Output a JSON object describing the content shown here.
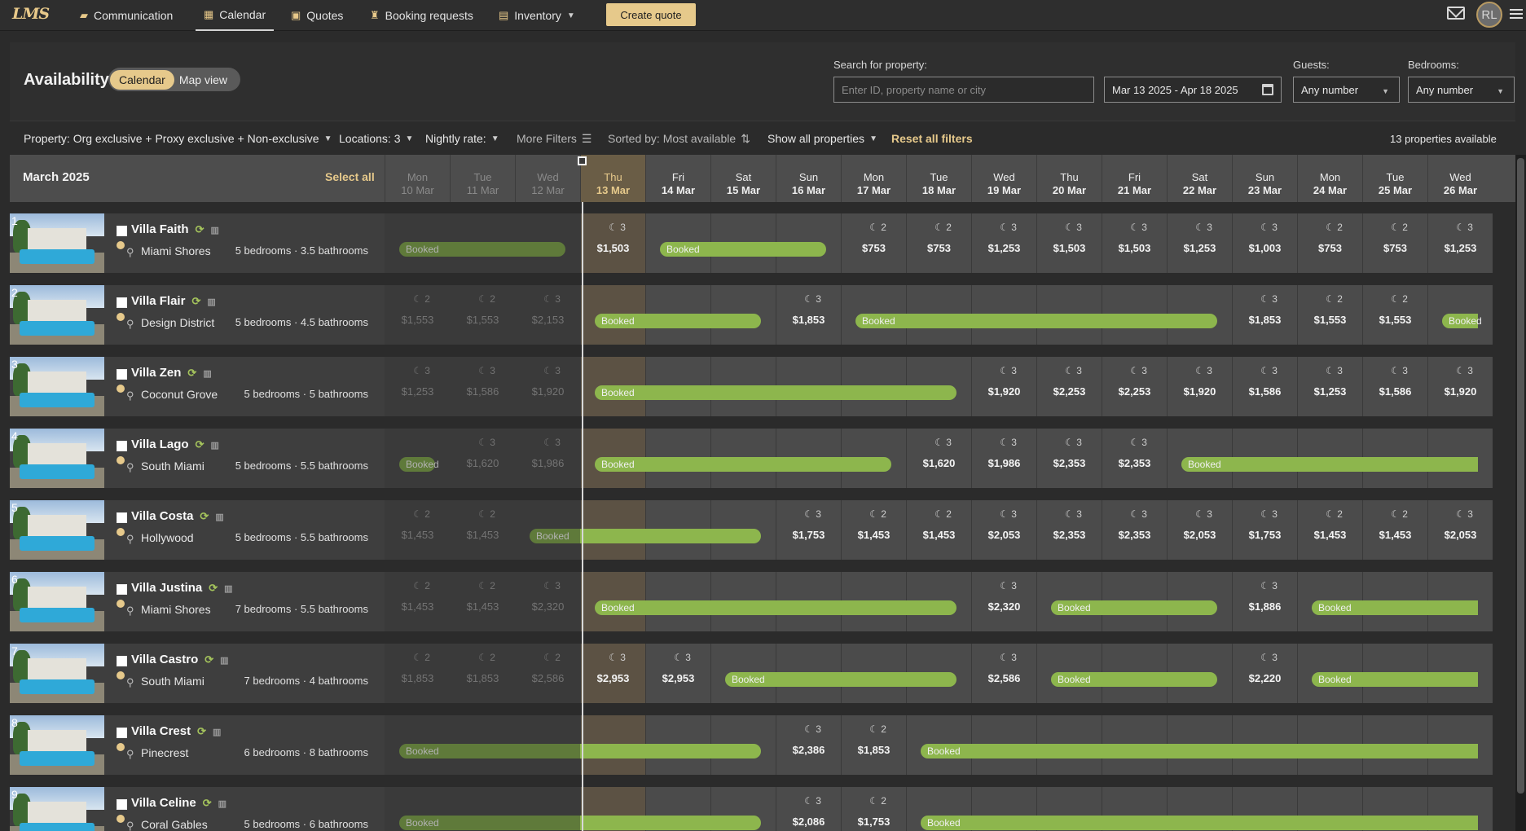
{
  "nav": {
    "logo": "LMS",
    "items": [
      {
        "label": "Communication",
        "icon": "chat-icon"
      },
      {
        "label": "Calendar",
        "icon": "calendar-icon",
        "active": true
      },
      {
        "label": "Quotes",
        "icon": "quote-icon"
      },
      {
        "label": "Booking requests",
        "icon": "person-icon"
      },
      {
        "label": "Inventory",
        "icon": "inventory-icon"
      }
    ],
    "create_quote": "Create quote",
    "user_initials": "RL"
  },
  "toolbar": {
    "title": "Availability",
    "view_calendar": "Calendar",
    "view_map": "Map view",
    "search_label": "Search for property:",
    "search_placeholder": "Enter ID, property name or city",
    "date_range": "Mar 13 2025 - Apr 18 2025",
    "guests_label": "Guests:",
    "guests_value": "Any number",
    "bedrooms_label": "Bedrooms:",
    "bedrooms_value": "Any number"
  },
  "filters": {
    "property": "Property: Org exclusive + Proxy exclusive + Non-exclusive",
    "locations": "Locations: 3",
    "nightly_rate": "Nightly rate:",
    "more_filters": "More Filters",
    "sorted_by": "Sorted by: Most available",
    "show_all": "Show all properties",
    "reset": "Reset all filters",
    "count": "13 properties available"
  },
  "grid": {
    "month": "March 2025",
    "select_all": "Select all",
    "days": [
      {
        "dow": "Mon",
        "date": "10 Mar",
        "past": true
      },
      {
        "dow": "Tue",
        "date": "11 Mar",
        "past": true
      },
      {
        "dow": "Wed",
        "date": "12 Mar",
        "past": true
      },
      {
        "dow": "Thu",
        "date": "13 Mar",
        "today": true
      },
      {
        "dow": "Fri",
        "date": "14 Mar"
      },
      {
        "dow": "Sat",
        "date": "15 Mar"
      },
      {
        "dow": "Sun",
        "date": "16 Mar"
      },
      {
        "dow": "Mon",
        "date": "17 Mar"
      },
      {
        "dow": "Tue",
        "date": "18 Mar"
      },
      {
        "dow": "Wed",
        "date": "19 Mar"
      },
      {
        "dow": "Thu",
        "date": "20 Mar"
      },
      {
        "dow": "Fri",
        "date": "21 Mar"
      },
      {
        "dow": "Sat",
        "date": "22 Mar"
      },
      {
        "dow": "Sun",
        "date": "23 Mar"
      },
      {
        "dow": "Mon",
        "date": "24 Mar"
      },
      {
        "dow": "Tue",
        "date": "25 Mar"
      },
      {
        "dow": "Wed",
        "date": "26 Mar"
      }
    ],
    "booked_label": "Booked",
    "properties": [
      {
        "num": "1",
        "name": "Villa Faith",
        "location": "Miami Shores",
        "beds": "5 bedrooms · 3.5 bathrooms",
        "bookings": [
          [
            0,
            3
          ],
          [
            4,
            7
          ]
        ],
        "cells": [
          null,
          null,
          null,
          [
            "3",
            "$1,503"
          ],
          null,
          null,
          null,
          [
            "2",
            "$753"
          ],
          [
            "2",
            "$753"
          ],
          [
            "3",
            "$1,253"
          ],
          [
            "3",
            "$1,503"
          ],
          [
            "3",
            "$1,503"
          ],
          [
            "3",
            "$1,253"
          ],
          [
            "3",
            "$1,003"
          ],
          [
            "2",
            "$753"
          ],
          [
            "2",
            "$753"
          ],
          [
            "3",
            "$1,253"
          ]
        ]
      },
      {
        "num": "2",
        "name": "Villa Flair",
        "location": "Design District",
        "beds": "5 bedrooms · 4.5 bathrooms",
        "bookings": [
          [
            3,
            6
          ],
          [
            7,
            13
          ],
          [
            16,
            17
          ]
        ],
        "cells": [
          [
            "2",
            "$1,553"
          ],
          [
            "2",
            "$1,553"
          ],
          [
            "3",
            "$2,153"
          ],
          null,
          null,
          null,
          [
            "3",
            "$1,853"
          ],
          null,
          null,
          null,
          null,
          null,
          null,
          [
            "3",
            "$1,853"
          ],
          [
            "2",
            "$1,553"
          ],
          [
            "2",
            "$1,553"
          ],
          null
        ]
      },
      {
        "num": "3",
        "name": "Villa Zen",
        "location": "Coconut Grove",
        "beds": "5 bedrooms · 5 bathrooms",
        "bookings": [
          [
            3,
            9
          ]
        ],
        "cells": [
          [
            "3",
            "$1,253"
          ],
          [
            "3",
            "$1,586"
          ],
          [
            "3",
            "$1,920"
          ],
          null,
          null,
          null,
          null,
          null,
          null,
          [
            "3",
            "$1,920"
          ],
          [
            "3",
            "$2,253"
          ],
          [
            "3",
            "$2,253"
          ],
          [
            "3",
            "$1,920"
          ],
          [
            "3",
            "$1,586"
          ],
          [
            "3",
            "$1,253"
          ],
          [
            "3",
            "$1,586"
          ],
          [
            "3",
            "$1,920"
          ]
        ]
      },
      {
        "num": "4",
        "name": "Villa Lago",
        "location": "South Miami",
        "beds": "5 bedrooms · 5.5 bathrooms",
        "bookings": [
          [
            0,
            1
          ],
          [
            3,
            8
          ],
          [
            12,
            17
          ]
        ],
        "cells": [
          null,
          [
            "3",
            "$1,620"
          ],
          [
            "3",
            "$1,986"
          ],
          null,
          null,
          null,
          null,
          null,
          [
            "3",
            "$1,620"
          ],
          [
            "3",
            "$1,986"
          ],
          [
            "3",
            "$2,353"
          ],
          [
            "3",
            "$2,353"
          ],
          null,
          null,
          null,
          null,
          null
        ]
      },
      {
        "num": "5",
        "name": "Villa Costa",
        "location": "Hollywood",
        "beds": "5 bedrooms · 5.5 bathrooms",
        "bookings": [
          [
            2,
            6
          ]
        ],
        "cells": [
          [
            "2",
            "$1,453"
          ],
          [
            "2",
            "$1,453"
          ],
          null,
          null,
          null,
          null,
          [
            "3",
            "$1,753"
          ],
          [
            "2",
            "$1,453"
          ],
          [
            "2",
            "$1,453"
          ],
          [
            "3",
            "$2,053"
          ],
          [
            "3",
            "$2,353"
          ],
          [
            "3",
            "$2,353"
          ],
          [
            "3",
            "$2,053"
          ],
          [
            "3",
            "$1,753"
          ],
          [
            "2",
            "$1,453"
          ],
          [
            "2",
            "$1,453"
          ],
          [
            "3",
            "$2,053"
          ]
        ]
      },
      {
        "num": "6",
        "name": "Villa Justina",
        "location": "Miami Shores",
        "beds": "7 bedrooms · 5.5 bathrooms",
        "bookings": [
          [
            3,
            9
          ],
          [
            10,
            13
          ],
          [
            14,
            17
          ]
        ],
        "cells": [
          [
            "2",
            "$1,453"
          ],
          [
            "2",
            "$1,453"
          ],
          [
            "3",
            "$2,320"
          ],
          null,
          null,
          null,
          null,
          null,
          null,
          [
            "3",
            "$2,320"
          ],
          null,
          null,
          null,
          [
            "3",
            "$1,886"
          ],
          null,
          null,
          null
        ]
      },
      {
        "num": "7",
        "name": "Villa Castro",
        "location": "South Miami",
        "beds": "7 bedrooms · 4 bathrooms",
        "bookings": [
          [
            5,
            9
          ],
          [
            10,
            13
          ],
          [
            14,
            17
          ]
        ],
        "cells": [
          [
            "2",
            "$1,853"
          ],
          [
            "2",
            "$1,853"
          ],
          [
            "2",
            "$2,586"
          ],
          [
            "3",
            "$2,953"
          ],
          [
            "3",
            "$2,953"
          ],
          null,
          null,
          null,
          null,
          [
            "3",
            "$2,586"
          ],
          null,
          null,
          null,
          [
            "3",
            "$2,220"
          ],
          null,
          null,
          null
        ]
      },
      {
        "num": "8",
        "name": "Villa Crest",
        "location": "Pinecrest",
        "beds": "6 bedrooms · 8 bathrooms",
        "bookings": [
          [
            0,
            6
          ],
          [
            8,
            17
          ]
        ],
        "cells": [
          null,
          null,
          null,
          null,
          null,
          null,
          [
            "3",
            "$2,386"
          ],
          [
            "2",
            "$1,853"
          ],
          null,
          null,
          null,
          null,
          null,
          null,
          null,
          null,
          null
        ]
      },
      {
        "num": "9",
        "name": "Villa Celine",
        "location": "Coral Gables",
        "beds": "5 bedrooms · 6 bathrooms",
        "bookings": [
          [
            0,
            6
          ],
          [
            8,
            17
          ]
        ],
        "cells": [
          null,
          null,
          null,
          null,
          null,
          null,
          [
            "3",
            "$2,086"
          ],
          [
            "2",
            "$1,753"
          ],
          null,
          null,
          null,
          null,
          null,
          null,
          null,
          null,
          null
        ]
      }
    ]
  }
}
